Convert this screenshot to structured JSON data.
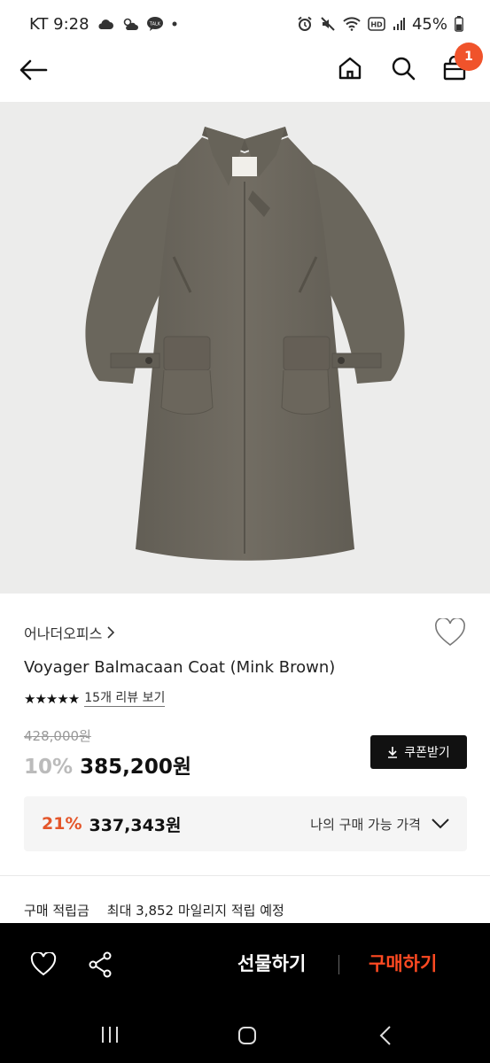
{
  "status": {
    "carrier_time": "KT 9:28",
    "battery": "45%",
    "left_icons": [
      "cloud-icon",
      "weather-icon",
      "talk-icon",
      "dot-icon"
    ],
    "right_icons": [
      "alarm-icon",
      "mute-icon",
      "wifi-icon",
      "hd-icon",
      "signal-icon",
      "battery-icon"
    ]
  },
  "header": {
    "cart_count": "1"
  },
  "product": {
    "brand": "어나더오피스",
    "name": "Voyager Balmacaan Coat (Mink Brown)",
    "rating_stars": "★★★★★",
    "rating_value": 5,
    "review_link": "15개 리뷰 보기",
    "original_price": "428,000원",
    "discount": "10%",
    "price": "385,200원",
    "coupon_label": "쿠폰받기",
    "my_price": {
      "discount": "21%",
      "price": "337,343원",
      "label": "나의 구매 가능 가격"
    },
    "points": {
      "label": "구매 적립금",
      "value": "최대 3,852 마일리지 적립 예정"
    }
  },
  "actions": {
    "gift_label": "선물하기",
    "buy_label": "구매하기"
  },
  "colors": {
    "accent": "#ff4a22",
    "badge": "#f0532b",
    "coat": "#6e6a60"
  }
}
